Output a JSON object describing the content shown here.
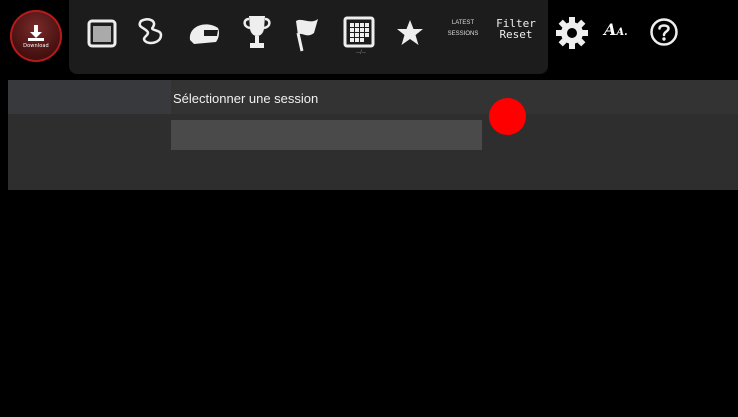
{
  "toolbar": {
    "download_label": "Download",
    "latest_line1": "LATEST",
    "latest_line2": "SESSIONS",
    "filter_line1": "Filter",
    "filter_line2": "Reset",
    "date_sub": "--/--",
    "aa_big": "A",
    "aa_small": "A.",
    "icons": [
      "download-icon",
      "folder-icon",
      "track-icon",
      "helmet-icon",
      "trophy-icon",
      "flag-icon",
      "calendar-icon",
      "star-icon",
      "gear-icon",
      "font-size-icon",
      "help-icon"
    ]
  },
  "session": {
    "label": "Sélectionner une session",
    "input_value": "",
    "input_placeholder": ""
  },
  "colors": {
    "background": "#000000",
    "panel": "#2e2e2e",
    "input": "#4a4a4a",
    "indicator": "#ff0000",
    "download_ring": "#b51a1a"
  }
}
